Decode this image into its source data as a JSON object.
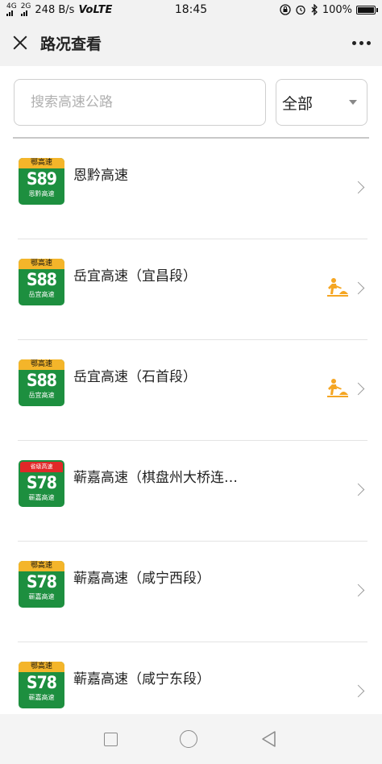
{
  "status_bar": {
    "signal_labels": [
      "4G",
      "2G"
    ],
    "speed": "248 B/s",
    "volte": "VoLTE",
    "time": "18:45",
    "battery": "100%",
    "battery_level": 1.0
  },
  "header": {
    "title": "路况查看"
  },
  "search": {
    "placeholder": "搜索高速公路",
    "filter_value": "全部"
  },
  "highways": [
    {
      "badge_top": "鄂高速",
      "code": "S89",
      "badge_name": "恩黔高速",
      "name": "恩黔高速",
      "badge_style": "yellow",
      "roadwork": false
    },
    {
      "badge_top": "鄂高速",
      "code": "S88",
      "badge_name": "岳宜高速",
      "name": "岳宜高速（宜昌段）",
      "badge_style": "yellow",
      "roadwork": true
    },
    {
      "badge_top": "鄂高速",
      "code": "S88",
      "badge_name": "岳宜高速",
      "name": "岳宜高速（石首段）",
      "badge_style": "yellow",
      "roadwork": true
    },
    {
      "badge_top": "省级高速",
      "code": "S78",
      "badge_name": "蕲嘉高速",
      "name": "蕲嘉高速（棋盘州大桥连…",
      "badge_style": "red",
      "roadwork": false
    },
    {
      "badge_top": "鄂高速",
      "code": "S78",
      "badge_name": "蕲嘉高速",
      "name": "蕲嘉高速（咸宁西段）",
      "badge_style": "yellow",
      "roadwork": false
    },
    {
      "badge_top": "鄂高速",
      "code": "S78",
      "badge_name": "蕲嘉高速",
      "name": "蕲嘉高速（咸宁东段）",
      "badge_style": "yellow",
      "roadwork": false
    }
  ],
  "icons": {
    "roadwork": "roadwork-icon",
    "chevron": "chevron-right-icon",
    "close": "close-icon",
    "more": "more-icon"
  },
  "colors": {
    "badge_green": "#1d8f3f",
    "badge_yellow": "#f4b52a",
    "badge_red": "#e12828",
    "roadwork_orange": "#f5a623"
  }
}
